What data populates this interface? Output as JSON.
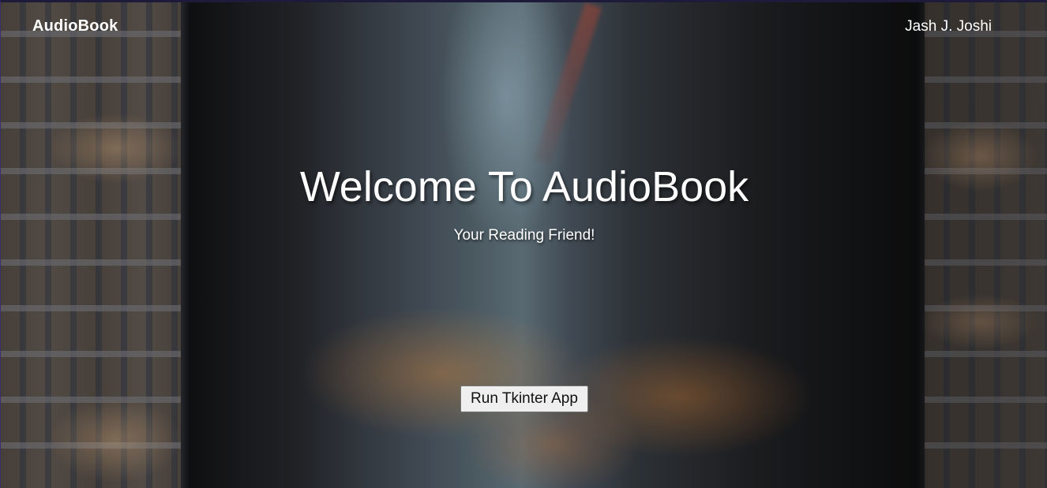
{
  "navbar": {
    "brand": "AudioBook",
    "author": "Jash J. Joshi"
  },
  "hero": {
    "title": "Welcome To AudioBook",
    "subtitle": "Your Reading Friend!",
    "button_label": "Run Tkinter App"
  },
  "colors": {
    "text": "#ffffff",
    "button_bg": "#efefef",
    "button_text": "#111111"
  }
}
